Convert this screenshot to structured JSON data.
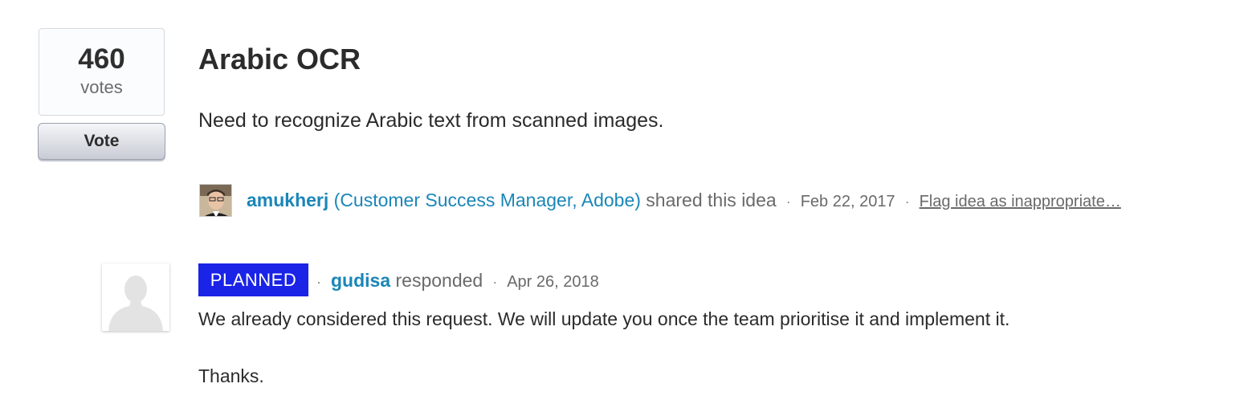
{
  "vote": {
    "count": "460",
    "unit": "votes",
    "button_label": "Vote"
  },
  "idea": {
    "title": "Arabic OCR",
    "description": "Need to recognize Arabic text from scanned images.",
    "author": {
      "username": "amukherj",
      "role": "(Customer Success Manager, Adobe)",
      "action": "shared this idea"
    },
    "date": "Feb 22, 2017",
    "flag_label": "Flag idea as inappropriate…"
  },
  "response": {
    "status": "PLANNED",
    "status_color": "#1a23e6",
    "responder": "gudisa",
    "action": "responded",
    "date": "Apr 26, 2018",
    "body": "We already considered this request. We will update you once the team prioritise it and implement it.",
    "closing": "Thanks."
  },
  "colors": {
    "link": "#1a86b8",
    "muted_text": "#6a6a6a"
  },
  "separator": "·"
}
